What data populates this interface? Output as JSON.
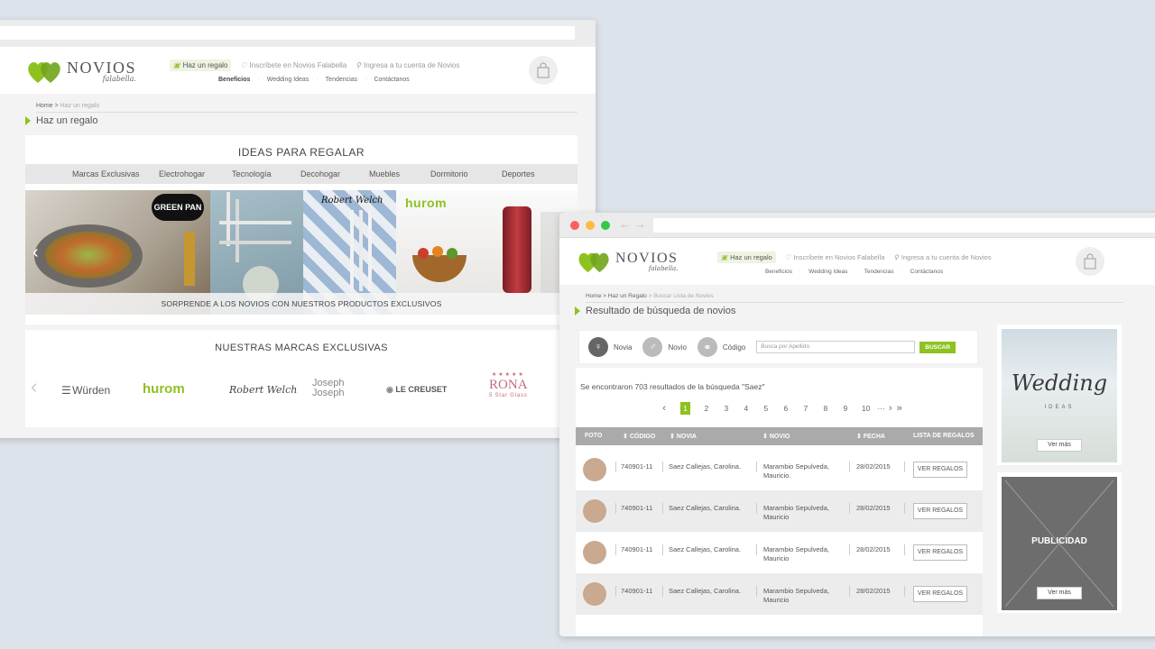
{
  "brand": {
    "name": "NOVIOS",
    "sub": "falabella.",
    "accent": "#8dc21f"
  },
  "header": {
    "links": [
      {
        "label": "Haz un regalo",
        "icon": "gift-icon"
      },
      {
        "label": "Inscríbete en Novios Falabella",
        "icon": "heart-icon"
      },
      {
        "label": "Ingresa a tu cuenta de Novios",
        "icon": "user-icon"
      }
    ],
    "subnav": [
      "Beneficios",
      "Wedding Ideas",
      "Tendencias",
      "Contáctanos"
    ],
    "cart_icon": "shopping-bag-icon"
  },
  "page1": {
    "breadcrumb": {
      "home": "Home",
      "sep": " > ",
      "current": "Haz un regalo"
    },
    "title": "Haz un regalo",
    "ideas_title": "IDEAS PARA REGALAR",
    "categories": [
      "Marcas Exclusivas",
      "Electrohogar",
      "Tecnología",
      "Decohogar",
      "Muebles",
      "Dormitorio",
      "Deportes"
    ],
    "banner_caption": "SORPRENDE A LOS NOVIOS CON NUESTROS PRODUCTOS EXCLUSIVOS",
    "banner_brands": [
      "GREEN PAN",
      "Robert Welch",
      "hurom"
    ],
    "brands_title": "NUESTRAS MARCAS EXCLUSIVAS",
    "brands": [
      "Würden",
      "hurom",
      "Robert Welch",
      "Joseph Joseph",
      "LE CREUSET",
      "RONA",
      "5 Star Glass"
    ]
  },
  "page2": {
    "breadcrumb": {
      "home": "Home",
      "mid": "Haz un Regalo",
      "current": "Buscar Lista de Novios"
    },
    "title": "Resultado de búsqueda de novios",
    "search": {
      "opt1": "Novia",
      "opt2": "Novio",
      "opt3": "Código",
      "placeholder": "Busca por Apellido",
      "button": "BUSCAR"
    },
    "result_text": "Se encontraron 703 resultados de la búsqueda \"Saez\"",
    "pages": [
      "1",
      "2",
      "3",
      "4",
      "5",
      "6",
      "7",
      "8",
      "9",
      "10",
      "···"
    ],
    "columns": {
      "foto": "FOTO",
      "codigo": "CÓDIGO",
      "novia": "NOVIA",
      "novio": "NOVIO",
      "fecha": "FECHA",
      "lista": "LISTA DE REGALOS"
    },
    "rows": [
      {
        "codigo": "740901-11",
        "novia": "Saez Callejas, Carolina.",
        "novio1": "Marambio Sepulveda,",
        "novio2": "Mauricio.",
        "fecha": "28/02/2015",
        "btn": "VER REGALOS"
      },
      {
        "codigo": "740901-11",
        "novia": "Saez Callejas, Carolina.",
        "novio1": "Marambio Sepulveda,",
        "novio2": "Mauricio",
        "fecha": "28/02/2015",
        "btn": "VER REGALOS"
      },
      {
        "codigo": "740901-11",
        "novia": "Saez Callejas, Carolina.",
        "novio1": "Marambio Sepulveda,",
        "novio2": "Mauricio",
        "fecha": "28/02/2015",
        "btn": "VER REGALOS"
      },
      {
        "codigo": "740901-11",
        "novia": "Saez Callejas, Carolina.",
        "novio1": "Marambio Sepulveda,",
        "novio2": "Mauricio",
        "fecha": "28/02/2015",
        "btn": "VER REGALOS"
      }
    ],
    "side1": {
      "title": "Wedding",
      "sub": "IDEAS",
      "btn": "Ver más"
    },
    "side2": {
      "title": "PUBLICIDAD",
      "btn": "Ver más"
    }
  }
}
